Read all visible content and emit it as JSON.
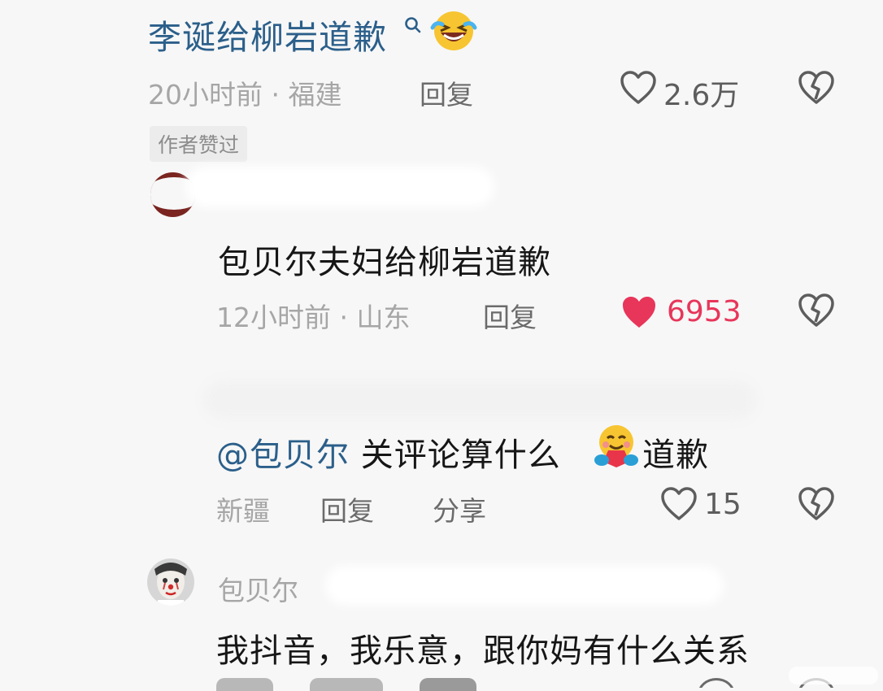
{
  "comment1": {
    "text": "李诞给柳岩道歉",
    "time": "20小时前",
    "location": "福建",
    "reply": "回复",
    "likes": "2.6万",
    "badge": "作者赞过"
  },
  "comment2": {
    "text": "包贝尔夫妇给柳岩道歉",
    "time": "12小时前",
    "location": "山东",
    "reply": "回复",
    "likes": "6953"
  },
  "comment3": {
    "mention": "@包贝尔",
    "text_before": "关评论算什么",
    "text_after": "道歉",
    "location": "新疆",
    "reply": "回复",
    "share": "分享",
    "likes": "15"
  },
  "comment4": {
    "username": "包贝尔",
    "text": "我抖音，我乐意，跟你妈有什么关系"
  },
  "colors": {
    "accent_link": "#2b5f8a",
    "liked_red": "#e8355a",
    "meta_gray": "#a6a6a6"
  },
  "icons": {
    "heart": "heart-icon",
    "broken_heart": "dislike-icon",
    "search": "search-icon"
  }
}
